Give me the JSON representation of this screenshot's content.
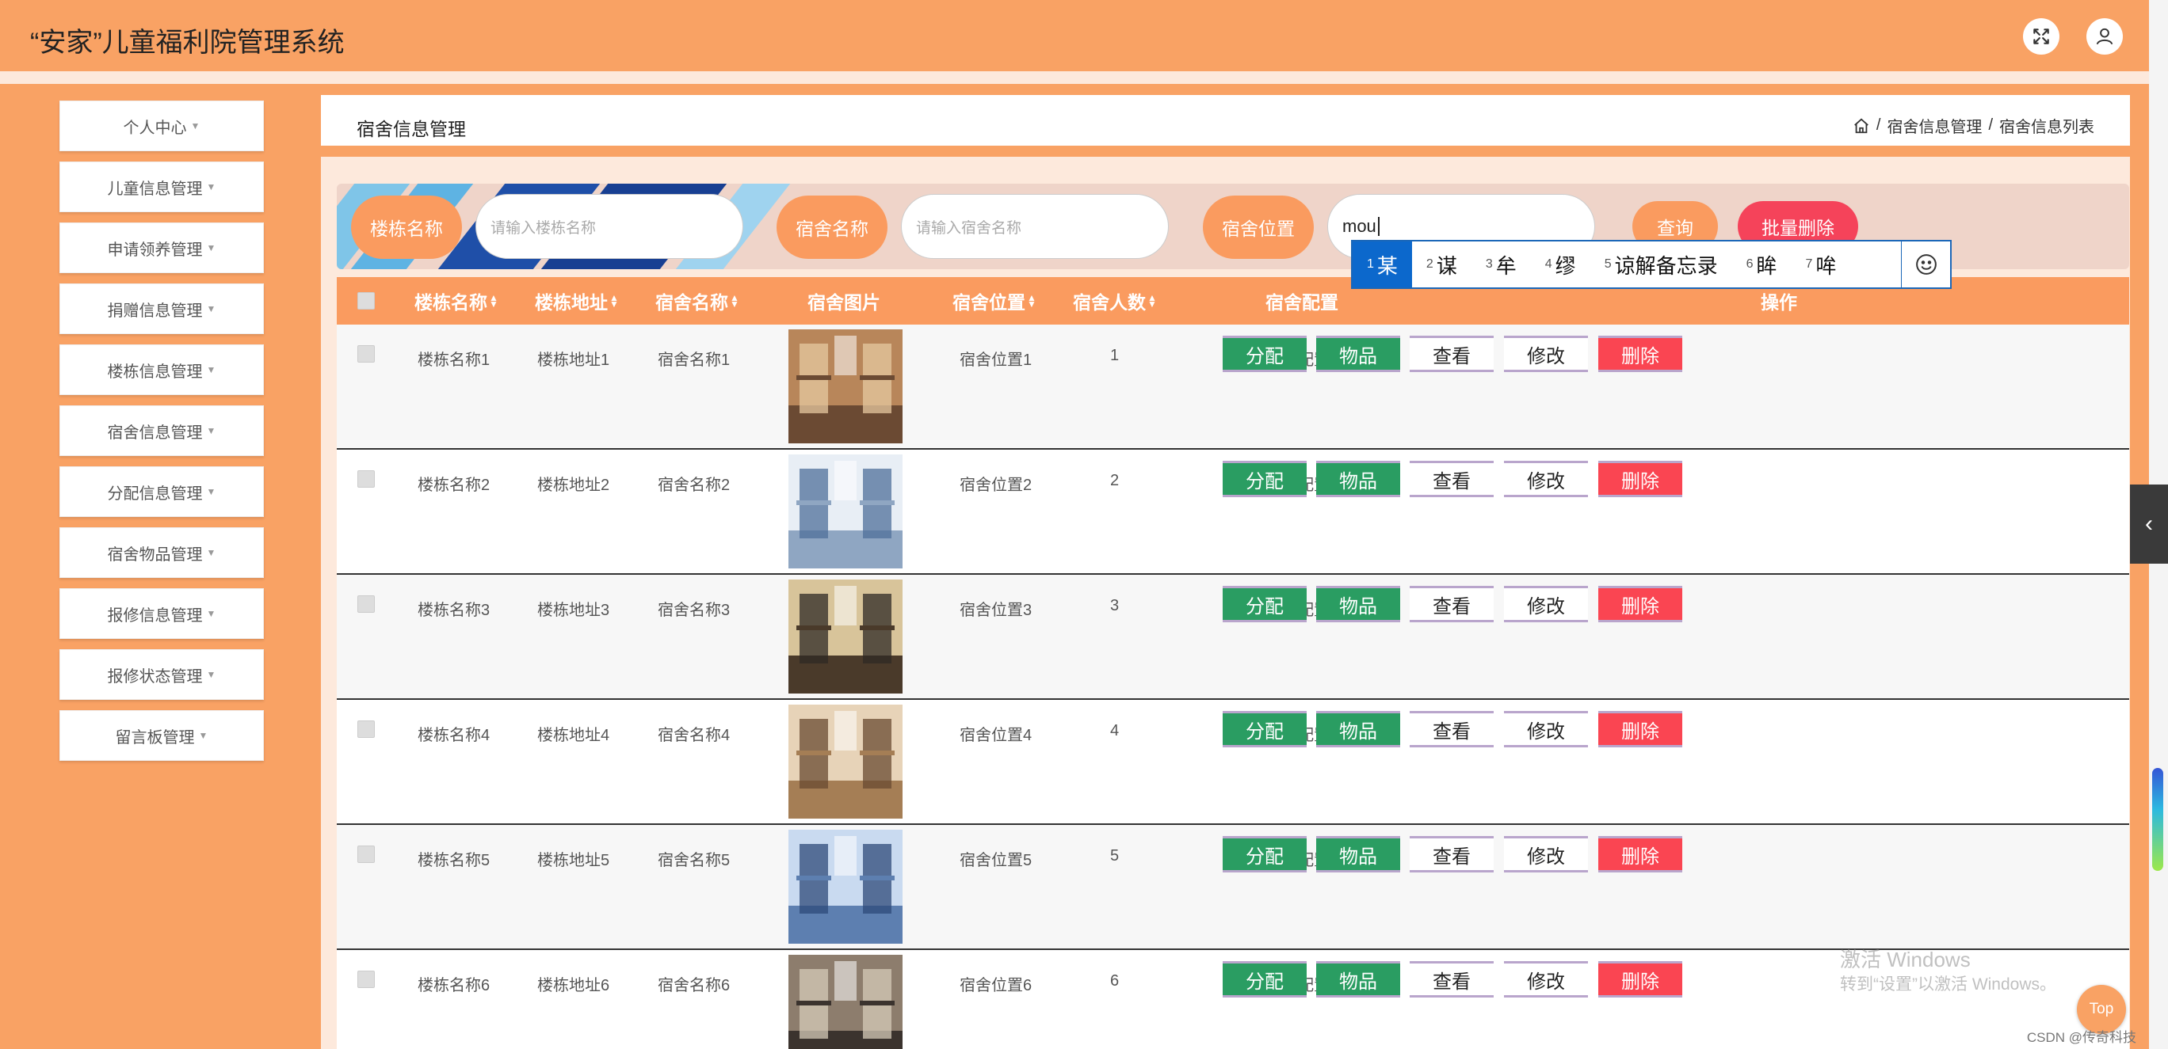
{
  "app": {
    "title": "“安家”儿童福利院管理系统"
  },
  "header_icons": {
    "fullscreen": "fullscreen-icon",
    "user": "user-icon"
  },
  "sidebar": {
    "items": [
      {
        "label": "个人中心"
      },
      {
        "label": "儿童信息管理"
      },
      {
        "label": "申请领养管理"
      },
      {
        "label": "捐赠信息管理"
      },
      {
        "label": "楼栋信息管理"
      },
      {
        "label": "宿舍信息管理"
      },
      {
        "label": "分配信息管理"
      },
      {
        "label": "宿舍物品管理"
      },
      {
        "label": "报修信息管理"
      },
      {
        "label": "报修状态管理"
      },
      {
        "label": "留言板管理"
      }
    ]
  },
  "page": {
    "heading": "宿舍信息管理",
    "breadcrumb": [
      "宿舍信息管理",
      "宿舍信息列表"
    ],
    "separator": "/"
  },
  "search": {
    "building_label": "楼栋名称",
    "building_placeholder": "请输入楼栋名称",
    "dorm_label": "宿舍名称",
    "dorm_placeholder": "请输入宿舍名称",
    "location_label": "宿舍位置",
    "location_value": "mou",
    "query_button": "查询",
    "batch_delete_button": "批量删除"
  },
  "ime": {
    "candidates": [
      {
        "num": "1",
        "text": "某"
      },
      {
        "num": "2",
        "text": "谋"
      },
      {
        "num": "3",
        "text": "牟"
      },
      {
        "num": "4",
        "text": "缪"
      },
      {
        "num": "5",
        "text": "谅解备忘录"
      },
      {
        "num": "6",
        "text": "眸"
      },
      {
        "num": "7",
        "text": "哞"
      }
    ],
    "emoji_icon": "smiley-icon"
  },
  "table": {
    "columns": [
      "楼栋名称",
      "楼栋地址",
      "宿舍名称",
      "宿舍图片",
      "宿舍位置",
      "宿舍人数",
      "宿舍配置",
      "操作"
    ],
    "actions": [
      "分配",
      "物品",
      "查看",
      "修改",
      "删除"
    ],
    "rows": [
      {
        "building": "楼栋名称1",
        "address": "楼栋地址1",
        "dorm": "宿舍名称1",
        "location": "宿舍位置1",
        "count": "1",
        "config": "宿舍配置1"
      },
      {
        "building": "楼栋名称2",
        "address": "楼栋地址2",
        "dorm": "宿舍名称2",
        "location": "宿舍位置2",
        "count": "2",
        "config": "宿舍配置2"
      },
      {
        "building": "楼栋名称3",
        "address": "楼栋地址3",
        "dorm": "宿舍名称3",
        "location": "宿舍位置3",
        "count": "3",
        "config": "宿舍配置3"
      },
      {
        "building": "楼栋名称4",
        "address": "楼栋地址4",
        "dorm": "宿舍名称4",
        "location": "宿舍位置4",
        "count": "4",
        "config": "宿舍配置4"
      },
      {
        "building": "楼栋名称5",
        "address": "楼栋地址5",
        "dorm": "宿舍名称5",
        "location": "宿舍位置5",
        "count": "5",
        "config": "宿舍配置5"
      },
      {
        "building": "楼栋名称6",
        "address": "楼栋地址6",
        "dorm": "宿舍名称6",
        "location": "宿舍位置6",
        "count": "6",
        "config": "宿舍配置6"
      }
    ]
  },
  "widgets": {
    "top_button": "Top",
    "watermark_line1": "激活 Windows",
    "watermark_line2": "转到“设置”以激活 Windows。",
    "credit": "CSDN @传奇科技"
  },
  "colors": {
    "brand_orange": "#f9a264",
    "action_green": "#2a9d62",
    "action_red": "#fa4552",
    "ime_blue": "#0c68cc"
  }
}
